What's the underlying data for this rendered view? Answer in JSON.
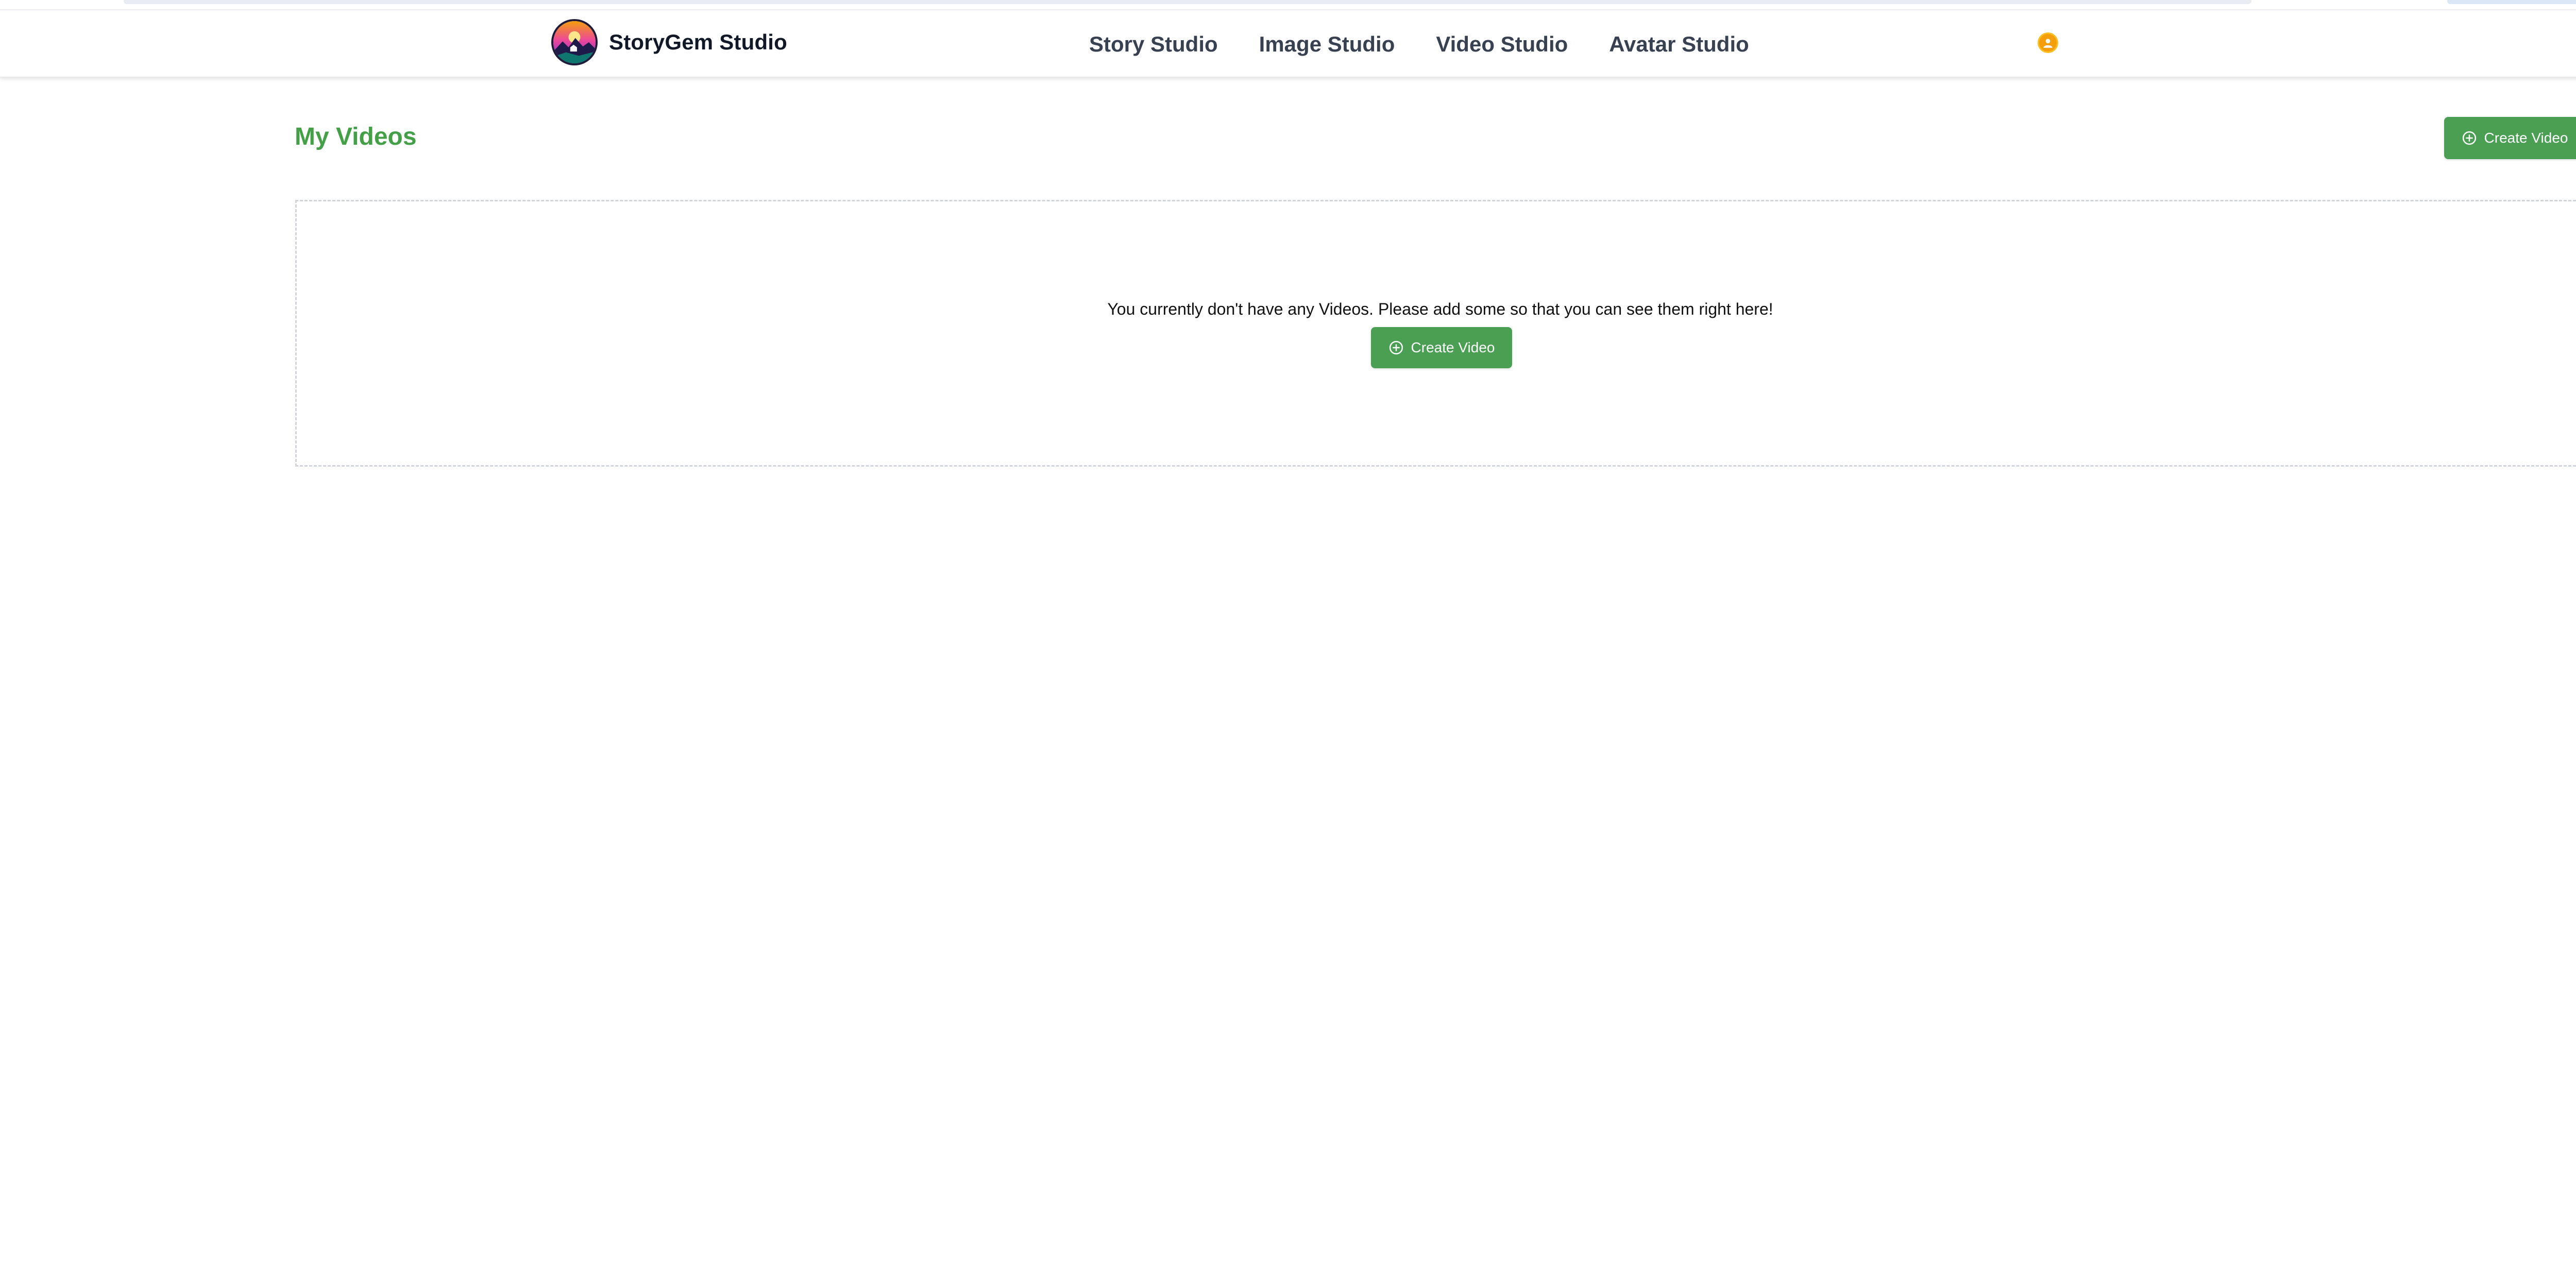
{
  "header": {
    "brand_name": "StoryGem Studio",
    "nav": [
      {
        "label": "Story Studio"
      },
      {
        "label": "Image Studio"
      },
      {
        "label": "Video Studio"
      },
      {
        "label": "Avatar Studio"
      }
    ],
    "user_icon": "user-avatar-icon"
  },
  "main": {
    "title": "My Videos",
    "create_button_label": "Create Video",
    "create_button_icon": "plus-circle-icon",
    "empty_state": {
      "message": "You currently don't have any Videos. Please add some so that you can see them right here!",
      "button_label": "Create Video"
    }
  },
  "colors": {
    "accent_green": "#4a9f53",
    "title_green": "#43a047",
    "user_badge": "#f59e0b"
  }
}
